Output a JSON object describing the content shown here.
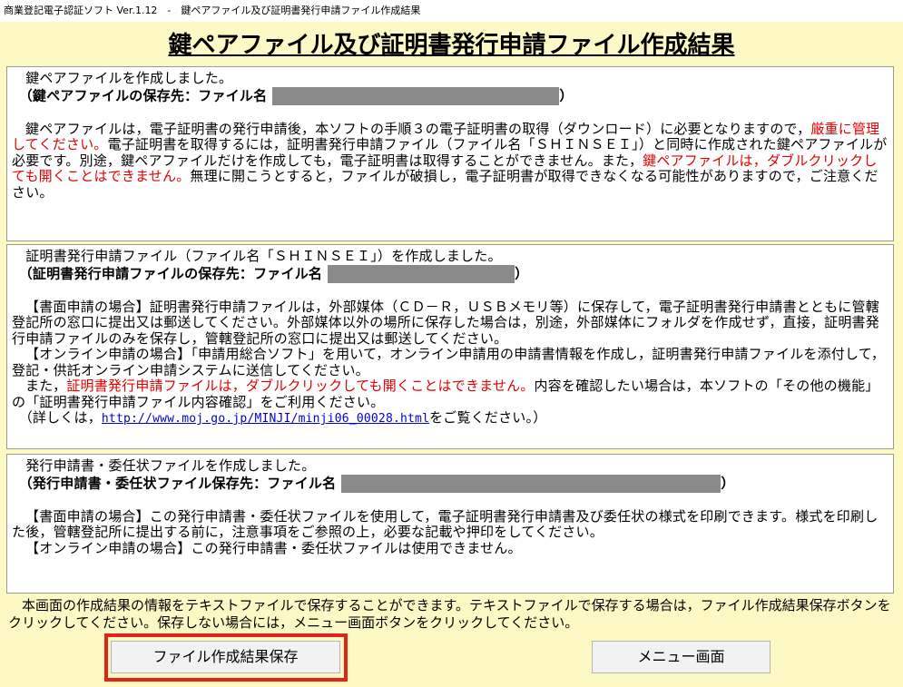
{
  "window": {
    "title": "商業登記電子認証ソフト Ver.1.12　-　鍵ペアファイル及び証明書発行申請ファイル作成結果"
  },
  "heading": "鍵ペアファイル及び証明書発行申請ファイル作成結果",
  "panel1": {
    "line1": "　鍵ペアファイルを作成しました。",
    "path_label": "　（鍵ペアファイルの保存先：ファイル名",
    "path_close": "）",
    "para": [
      {
        "t": "鍵ペアファイルは，電子証明書の発行申請後，本ソフトの手順３の電子証明書の取得（ダウンロード）に必要となりますので，",
        "red": false
      },
      {
        "t": "厳重に管理してください。",
        "red": true
      },
      {
        "t": "電子証明書を取得するには，証明書発行申請ファイル（ファイル名「ＳＨＩＮＳＥＩ」）と同時に作成された鍵ペアファイルが必要です。別途，鍵ペアファイルだけを作成しても，電子証明書は取得することができません。また，",
        "red": false
      },
      {
        "t": "鍵ペアファイルは，ダブルクリックしても開くことはできません。",
        "red": true
      },
      {
        "t": "無理に開こうとすると，ファイルが破損し，電子証明書が取得できなくなる可能性がありますので，ご注意ください。",
        "red": false
      }
    ]
  },
  "panel2": {
    "line1": "　証明書発行申請ファイル（ファイル名「ＳＨＩＮＳＥＩ」）を作成しました。",
    "path_label": "　（証明書発行申請ファイルの保存先：ファイル名",
    "path_close": "）",
    "para1": "【書面申請の場合】証明書発行申請ファイルは，外部媒体（ＣＤ－Ｒ，ＵＳＢメモリ等）に保存して，電子証明書発行申請書とともに管轄登記所の窓口に提出又は郵送してください。外部媒体以外の場所に保存した場合は，別途，外部媒体にフォルダを作成せず，直接，証明書発行申請ファイルのみを保存し，管轄登記所の窓口に提出又は郵送してください。",
    "para2": "【オンライン申請の場合】「申請用総合ソフト」を用いて，オンライン申請用の申請書情報を作成し，証明書発行申請ファイルを添付して，登記・供託オンライン申請システムに送信してください。",
    "para3_a": "また，",
    "para3_red": "証明書発行申請ファイルは，ダブルクリックしても開くことはできません。",
    "para3_b": "内容を確認したい場合は，本ソフトの「その他の機能」の「証明書発行申請ファイル内容確認」をご利用ください。",
    "detail_pre": "　（詳しくは，",
    "detail_link": "http://www.moj.go.jp/MINJI/minji06_00028.html",
    "detail_post": "をご覧ください。）"
  },
  "panel3": {
    "line1": "　発行申請書・委任状ファイルを作成しました。",
    "path_label": "　（発行申請書・委任状ファイル保存先：ファイル名",
    "path_close": "）",
    "para1": "【書面申請の場合】この発行申請書・委任状ファイルを使用して，電子証明書発行申請書及び委任状の様式を印刷できます。様式を印刷した後，管轄登記所に提出する前に，注意事項をご参照の上，必要な記載や押印をしてください。",
    "para2": "【オンライン申請の場合】この発行申請書・委任状ファイルは使用できません。"
  },
  "footer": {
    "text": "　本画面の作成結果の情報をテキストファイルで保存することができます。テキストファイルで保存する場合は，ファイル作成結果保存ボタンをクリックしてください。保存しない場合には，メニュー画面ボタンをクリックしてください。"
  },
  "buttons": {
    "save": "ファイル作成結果保存",
    "menu": "メニュー画面"
  },
  "colors": {
    "background": "#fdf9c5",
    "red_text": "#e00000",
    "highlight": "#e2231a",
    "link": "#0000d0"
  }
}
